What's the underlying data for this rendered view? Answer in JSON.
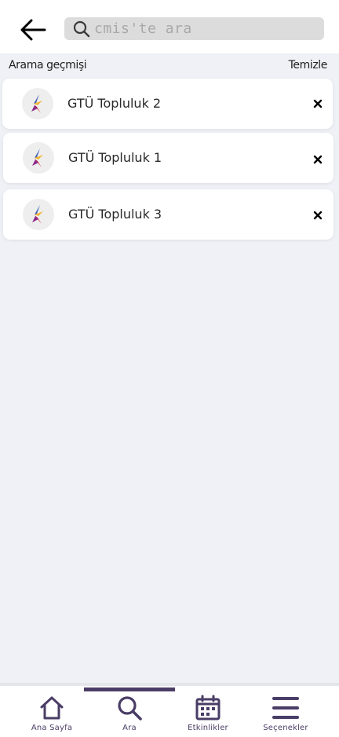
{
  "search": {
    "placeholder": "cmis'te ara"
  },
  "history": {
    "title": "Arama geçmişi",
    "clear_label": "Temizle",
    "items": [
      {
        "label": "GTÜ Topluluk 2"
      },
      {
        "label": "GTÜ Topluluk 1"
      },
      {
        "label": "GTÜ Topluluk 3"
      }
    ]
  },
  "nav": {
    "items": [
      {
        "label": "Ana Sayfa",
        "icon": "home-icon"
      },
      {
        "label": "Ara",
        "icon": "search-icon",
        "active": true
      },
      {
        "label": "Etkinlikler",
        "icon": "calendar-icon"
      },
      {
        "label": "Seçenekler",
        "icon": "menu-icon"
      }
    ]
  },
  "colors": {
    "accent": "#4a3d66",
    "background": "#eff1f6",
    "search_bg": "#dcdcdc"
  }
}
